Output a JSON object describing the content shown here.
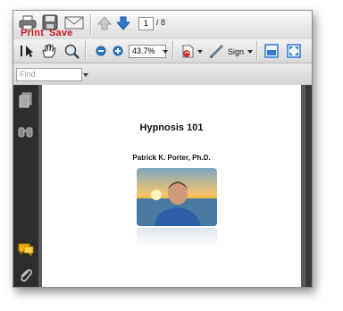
{
  "toolbar": {
    "print_label": "Print",
    "save_label": "Save",
    "current_page": "1",
    "total_pages": "/ 8",
    "zoom": "43.7%",
    "sign_label": "Sign"
  },
  "find": {
    "placeholder": "Find"
  },
  "document": {
    "title": "Hypnosis 101",
    "author": "Patrick K. Porter, Ph.D."
  },
  "colors": {
    "label_red": "#d0141a",
    "nav_blue": "#2f78d0",
    "panel_dark": "#2d2d2d"
  }
}
